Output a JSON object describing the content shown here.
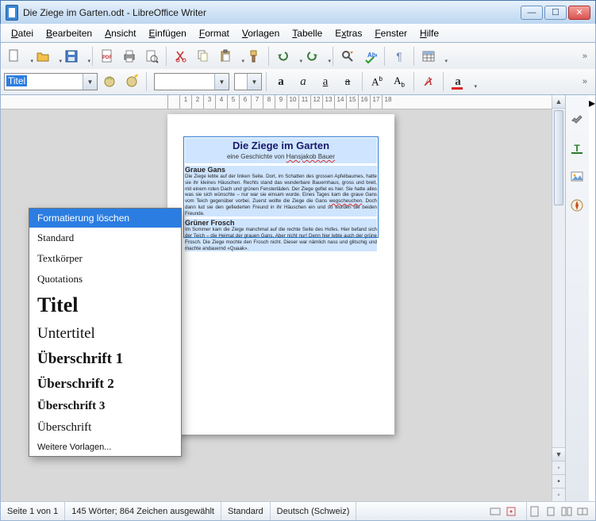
{
  "window": {
    "title": "Die Ziege im Garten.odt - LibreOffice Writer"
  },
  "menu": {
    "items": [
      "Datei",
      "Bearbeiten",
      "Ansicht",
      "Einfügen",
      "Format",
      "Vorlagen",
      "Tabelle",
      "Extras",
      "Fenster",
      "Hilfe"
    ]
  },
  "toolbar2": {
    "style_value": "Titel",
    "font_value": "",
    "size_value": ""
  },
  "style_dropdown": {
    "items": [
      {
        "label": "Formatierung löschen",
        "cls": "sel"
      },
      {
        "label": "Standard",
        "cls": "std"
      },
      {
        "label": "Textkörper",
        "cls": "std"
      },
      {
        "label": "Quotations",
        "cls": "std"
      },
      {
        "label": "Titel",
        "cls": "titel"
      },
      {
        "label": "Untertitel",
        "cls": "unter"
      },
      {
        "label": "Überschrift 1",
        "cls": "h1"
      },
      {
        "label": "Überschrift 2",
        "cls": "h2"
      },
      {
        "label": "Überschrift 3",
        "cls": "h3"
      },
      {
        "label": "Überschrift",
        "cls": "hx"
      },
      {
        "label": "Weitere Vorlagen...",
        "cls": "more"
      }
    ]
  },
  "ruler": {
    "labels": [
      "",
      "1",
      "2",
      "3",
      "4",
      "5",
      "6",
      "7",
      "8",
      "9",
      "10",
      "11",
      "12",
      "13",
      "14",
      "15",
      "16",
      "17",
      "18"
    ]
  },
  "doc": {
    "title": "Die Ziege im Garten",
    "subtitle_pre": "eine Geschichte von ",
    "subtitle_auth": "Hansjakob Bauer",
    "h1": "Graue Gans",
    "p1a": "Die Ziege lebte auf der linken Seite. Dort, im Schatten des grossen Apfelbaumes, hatte sie ihr kleines Häuschen. Rechts stand das wunderbare Bauernhaus, gross und breit, mit einem roten Dach und grünen Fensterläden. Der Ziege gefiel es hier. Sie hatte alles was sie sich wünschte – nur war sie einsam wurde. Eines Tages kam die graue Gans vom Teich gegenüber vorbei. Zuerst wollte die Ziege die Gans ",
    "p1squig": "wegscheuchen",
    "p1b": ". Doch dann lud sie den gefiederten Freund in ihr Häuschen ein und so wurden die beiden Freunde.",
    "h2": "Grüner Frosch",
    "p2": "Im Sommer kam die Ziege manchmal auf die rechte Seite des Hofes. Hier befand sich der Teich – die Heimat der grauen Gans. Aber nicht nur! Denn hier lebte auch der grüne Frosch. Die Ziege mochte den Frosch nicht. Dieser war nämlich nass und glitschig und machte andauernd «Quaak»."
  },
  "status": {
    "page": "Seite 1 von 1",
    "words": "145 Wörter; 864 Zeichen ausgewählt",
    "style": "Standard",
    "lang": "Deutsch (Schweiz)"
  }
}
